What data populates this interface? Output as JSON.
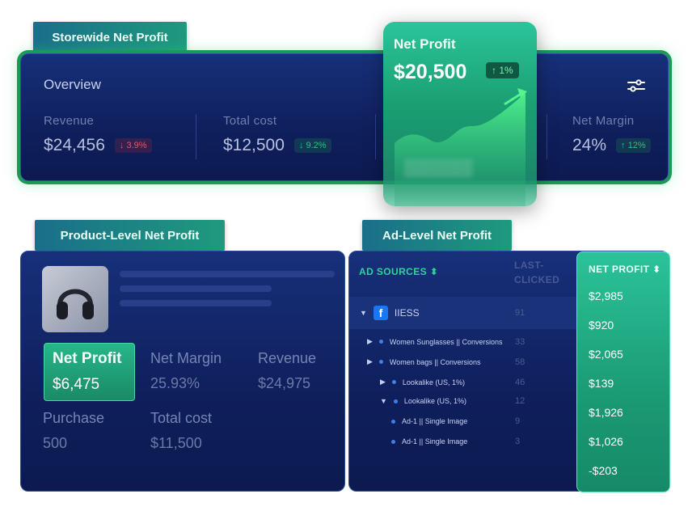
{
  "storewide": {
    "tag": "Storewide Net Profit",
    "overview_title": "Overview",
    "metrics": [
      {
        "label": "Revenue",
        "value": "$24,456",
        "change": "↓ 3.9%",
        "direction": "down"
      },
      {
        "label": "Total cost",
        "value": "$12,500",
        "change": "↓ 9.2%",
        "direction": "up"
      },
      {
        "label": "Net Margin",
        "value": "24%",
        "change": "↑ 12%",
        "direction": "up"
      }
    ],
    "net_profit_card": {
      "label": "Net Profit",
      "value": "$20,500",
      "change": "↑ 1%"
    },
    "icon": "sliders-icon"
  },
  "product": {
    "tag": "Product-Level Net Profit",
    "image": "headphones",
    "net_profit": {
      "label": "Net Profit",
      "value": "$6,475"
    },
    "net_margin": {
      "label": "Net Margin",
      "value": "25.93%"
    },
    "revenue": {
      "label": "Revenue",
      "value": "$24,975"
    },
    "purchase": {
      "label": "Purchase",
      "value": "500"
    },
    "total_cost": {
      "label": "Total cost",
      "value": "$11,500"
    }
  },
  "ad": {
    "tag": "Ad-Level Net Profit",
    "col_sources": "AD SOURCES ⬍",
    "col_last_1": "LAST-",
    "col_last_2": "CLICKED",
    "col_net_profit": "NET PROFIT ⬍",
    "rows": [
      {
        "name": "IIESS",
        "count": "91",
        "profit": "$2,985"
      },
      {
        "name": "Women Sunglasses || Conversions",
        "count": "33",
        "profit": "$920"
      },
      {
        "name": "Women bags || Conversions",
        "count": "58",
        "profit": "$2,065"
      },
      {
        "name": "Lookalike (US, 1%)",
        "count": "46",
        "profit": "$139"
      },
      {
        "name": "Lookalike (US, 1%)",
        "count": "12",
        "profit": "$1,926"
      },
      {
        "name": "Ad-1 || Single Image",
        "count": "9",
        "profit": "$1,026"
      },
      {
        "name": "Ad-1 || Single Image",
        "count": "3",
        "profit": "-$203"
      }
    ]
  },
  "colors": {
    "accent_green": "#1fa97e",
    "card_navy": "#13286a",
    "down_red": "#d65b6c",
    "up_green": "#27c47a"
  }
}
